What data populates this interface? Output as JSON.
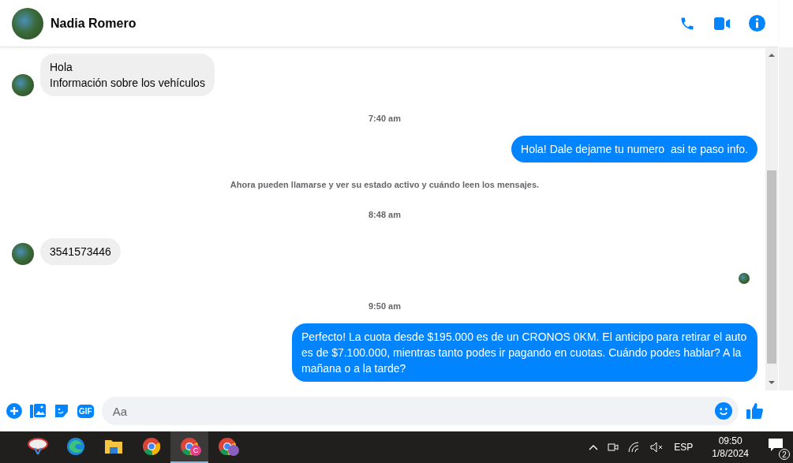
{
  "header": {
    "name": "Nadia Romero"
  },
  "messages": [
    {
      "kind": "incoming",
      "lines": [
        "Hola",
        "Información sobre los vehículos"
      ]
    },
    {
      "kind": "time",
      "text": "7:40 am"
    },
    {
      "kind": "outgoing",
      "lines": [
        "Hola! Dale dejame tu numero  asi te paso info."
      ]
    },
    {
      "kind": "notice",
      "text": "Ahora pueden llamarse y ver su estado activo y cuándo leen los mensajes."
    },
    {
      "kind": "time",
      "text": "8:48 am"
    },
    {
      "kind": "incoming",
      "lines": [
        "3541573446"
      ]
    },
    {
      "kind": "seen"
    },
    {
      "kind": "time",
      "text": "9:50 am"
    },
    {
      "kind": "outgoing",
      "lines": [
        "Perfecto! La cuota desde $195.000 es de un CRONOS 0KM. El anticipo para retirar el auto es de $7.100.000, mientras tanto podes ir pagando en cuotas. Cuándo podes hablar? A la mañana o a la tarde?"
      ]
    }
  ],
  "composer": {
    "placeholder": "Aa",
    "gif": "GIF"
  },
  "taskbar": {
    "apps": [
      {
        "kind": "snip",
        "selected": false
      },
      {
        "kind": "edge",
        "selected": false
      },
      {
        "kind": "folder",
        "selected": false
      },
      {
        "kind": "chrome",
        "selected": false
      },
      {
        "kind": "chrome",
        "badge": "C",
        "selected": true
      },
      {
        "kind": "chrome",
        "selected": false,
        "lock": true
      }
    ],
    "language": "ESP",
    "time": "09:50",
    "date": "1/8/2024",
    "notifications": "2"
  }
}
